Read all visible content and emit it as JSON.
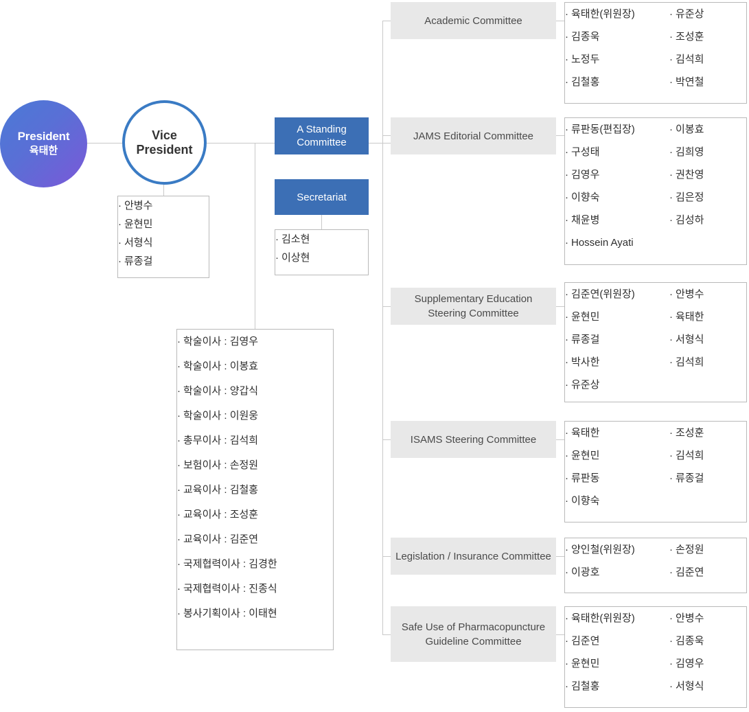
{
  "colors": {
    "president_gradient_start": "#4a7ad6",
    "president_gradient_end": "#7b58d8",
    "vp_border": "#3a7bc4",
    "blue_box": "#3c6fb5",
    "gray_box": "#e8e8e8",
    "line": "#c9c9c9",
    "member_box_border": "#b9b9b9"
  },
  "president": {
    "title": "President",
    "name": "육태한"
  },
  "vice_president": {
    "title": "Vice President",
    "members": [
      "안병수",
      "윤현민",
      "서형식",
      "류종걸"
    ]
  },
  "standing_committee": {
    "label": "A Standing Committee"
  },
  "secretariat": {
    "label": "Secretariat",
    "members": [
      "김소현",
      "이상현"
    ]
  },
  "directors": {
    "items": [
      "학술이사 : 김영우",
      "학술이사 : 이봉효",
      "학술이사 : 양갑식",
      "학술이사 : 이원웅",
      "총무이사 : 김석희",
      "보험이사 : 손정원",
      "교육이사 : 김철홍",
      "교육이사 : 조성훈",
      "교육이사 : 김준연",
      "국제협력이사 : 김경한",
      "국제협력이사 : 진종식",
      "봉사기획이사 : 이태현"
    ]
  },
  "committees": [
    {
      "name": "Academic Committee",
      "members_left": [
        "육태한(위원장)",
        "김종욱",
        "노정두",
        "김철홍"
      ],
      "members_right": [
        "유준상",
        "조성훈",
        "김석희",
        "박연철"
      ],
      "members_full": []
    },
    {
      "name": "JAMS Editorial Committee",
      "members_left": [
        "류판동(편집장)",
        "구성태",
        "김영우",
        "이향숙",
        "채윤병"
      ],
      "members_right": [
        "이봉효",
        "김희영",
        "권찬영",
        "김은정",
        "김성하"
      ],
      "members_full": [
        "Hossein Ayati"
      ]
    },
    {
      "name": "Supplementary Education Steering Committee",
      "members_left": [
        "김준연(위원장)",
        "윤현민",
        "류종걸",
        "박사한",
        "유준상"
      ],
      "members_right": [
        "안병수",
        "육태한",
        "서형식",
        "김석희"
      ],
      "members_full": []
    },
    {
      "name": "ISAMS Steering Committee",
      "members_left": [
        "육태한",
        "윤현민",
        "류판동",
        "이향숙"
      ],
      "members_right": [
        "조성훈",
        "김석희",
        "류종걸"
      ],
      "members_full": []
    },
    {
      "name": "Legislation / Insurance Committee",
      "members_left": [
        "양인철(위원장)",
        "이광호"
      ],
      "members_right": [
        "손정원",
        "김준연"
      ],
      "members_full": []
    },
    {
      "name": "Safe Use of Pharmacopuncture Guideline Committee",
      "members_left": [
        "육태한(위원장)",
        "김준연",
        "윤현민",
        "김철홍"
      ],
      "members_right": [
        "안병수",
        "김종욱",
        "김영우",
        "서형식"
      ],
      "members_full": []
    }
  ]
}
